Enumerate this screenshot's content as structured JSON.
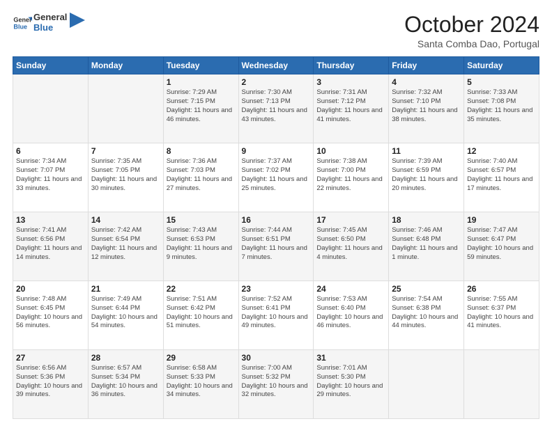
{
  "logo": {
    "text_general": "General",
    "text_blue": "Blue"
  },
  "header": {
    "title": "October 2024",
    "subtitle": "Santa Comba Dao, Portugal"
  },
  "weekdays": [
    "Sunday",
    "Monday",
    "Tuesday",
    "Wednesday",
    "Thursday",
    "Friday",
    "Saturday"
  ],
  "weeks": [
    [
      {
        "day": "",
        "sunrise": "",
        "sunset": "",
        "daylight": ""
      },
      {
        "day": "",
        "sunrise": "",
        "sunset": "",
        "daylight": ""
      },
      {
        "day": "1",
        "sunrise": "Sunrise: 7:29 AM",
        "sunset": "Sunset: 7:15 PM",
        "daylight": "Daylight: 11 hours and 46 minutes."
      },
      {
        "day": "2",
        "sunrise": "Sunrise: 7:30 AM",
        "sunset": "Sunset: 7:13 PM",
        "daylight": "Daylight: 11 hours and 43 minutes."
      },
      {
        "day": "3",
        "sunrise": "Sunrise: 7:31 AM",
        "sunset": "Sunset: 7:12 PM",
        "daylight": "Daylight: 11 hours and 41 minutes."
      },
      {
        "day": "4",
        "sunrise": "Sunrise: 7:32 AM",
        "sunset": "Sunset: 7:10 PM",
        "daylight": "Daylight: 11 hours and 38 minutes."
      },
      {
        "day": "5",
        "sunrise": "Sunrise: 7:33 AM",
        "sunset": "Sunset: 7:08 PM",
        "daylight": "Daylight: 11 hours and 35 minutes."
      }
    ],
    [
      {
        "day": "6",
        "sunrise": "Sunrise: 7:34 AM",
        "sunset": "Sunset: 7:07 PM",
        "daylight": "Daylight: 11 hours and 33 minutes."
      },
      {
        "day": "7",
        "sunrise": "Sunrise: 7:35 AM",
        "sunset": "Sunset: 7:05 PM",
        "daylight": "Daylight: 11 hours and 30 minutes."
      },
      {
        "day": "8",
        "sunrise": "Sunrise: 7:36 AM",
        "sunset": "Sunset: 7:03 PM",
        "daylight": "Daylight: 11 hours and 27 minutes."
      },
      {
        "day": "9",
        "sunrise": "Sunrise: 7:37 AM",
        "sunset": "Sunset: 7:02 PM",
        "daylight": "Daylight: 11 hours and 25 minutes."
      },
      {
        "day": "10",
        "sunrise": "Sunrise: 7:38 AM",
        "sunset": "Sunset: 7:00 PM",
        "daylight": "Daylight: 11 hours and 22 minutes."
      },
      {
        "day": "11",
        "sunrise": "Sunrise: 7:39 AM",
        "sunset": "Sunset: 6:59 PM",
        "daylight": "Daylight: 11 hours and 20 minutes."
      },
      {
        "day": "12",
        "sunrise": "Sunrise: 7:40 AM",
        "sunset": "Sunset: 6:57 PM",
        "daylight": "Daylight: 11 hours and 17 minutes."
      }
    ],
    [
      {
        "day": "13",
        "sunrise": "Sunrise: 7:41 AM",
        "sunset": "Sunset: 6:56 PM",
        "daylight": "Daylight: 11 hours and 14 minutes."
      },
      {
        "day": "14",
        "sunrise": "Sunrise: 7:42 AM",
        "sunset": "Sunset: 6:54 PM",
        "daylight": "Daylight: 11 hours and 12 minutes."
      },
      {
        "day": "15",
        "sunrise": "Sunrise: 7:43 AM",
        "sunset": "Sunset: 6:53 PM",
        "daylight": "Daylight: 11 hours and 9 minutes."
      },
      {
        "day": "16",
        "sunrise": "Sunrise: 7:44 AM",
        "sunset": "Sunset: 6:51 PM",
        "daylight": "Daylight: 11 hours and 7 minutes."
      },
      {
        "day": "17",
        "sunrise": "Sunrise: 7:45 AM",
        "sunset": "Sunset: 6:50 PM",
        "daylight": "Daylight: 11 hours and 4 minutes."
      },
      {
        "day": "18",
        "sunrise": "Sunrise: 7:46 AM",
        "sunset": "Sunset: 6:48 PM",
        "daylight": "Daylight: 11 hours and 1 minute."
      },
      {
        "day": "19",
        "sunrise": "Sunrise: 7:47 AM",
        "sunset": "Sunset: 6:47 PM",
        "daylight": "Daylight: 10 hours and 59 minutes."
      }
    ],
    [
      {
        "day": "20",
        "sunrise": "Sunrise: 7:48 AM",
        "sunset": "Sunset: 6:45 PM",
        "daylight": "Daylight: 10 hours and 56 minutes."
      },
      {
        "day": "21",
        "sunrise": "Sunrise: 7:49 AM",
        "sunset": "Sunset: 6:44 PM",
        "daylight": "Daylight: 10 hours and 54 minutes."
      },
      {
        "day": "22",
        "sunrise": "Sunrise: 7:51 AM",
        "sunset": "Sunset: 6:42 PM",
        "daylight": "Daylight: 10 hours and 51 minutes."
      },
      {
        "day": "23",
        "sunrise": "Sunrise: 7:52 AM",
        "sunset": "Sunset: 6:41 PM",
        "daylight": "Daylight: 10 hours and 49 minutes."
      },
      {
        "day": "24",
        "sunrise": "Sunrise: 7:53 AM",
        "sunset": "Sunset: 6:40 PM",
        "daylight": "Daylight: 10 hours and 46 minutes."
      },
      {
        "day": "25",
        "sunrise": "Sunrise: 7:54 AM",
        "sunset": "Sunset: 6:38 PM",
        "daylight": "Daylight: 10 hours and 44 minutes."
      },
      {
        "day": "26",
        "sunrise": "Sunrise: 7:55 AM",
        "sunset": "Sunset: 6:37 PM",
        "daylight": "Daylight: 10 hours and 41 minutes."
      }
    ],
    [
      {
        "day": "27",
        "sunrise": "Sunrise: 6:56 AM",
        "sunset": "Sunset: 5:36 PM",
        "daylight": "Daylight: 10 hours and 39 minutes."
      },
      {
        "day": "28",
        "sunrise": "Sunrise: 6:57 AM",
        "sunset": "Sunset: 5:34 PM",
        "daylight": "Daylight: 10 hours and 36 minutes."
      },
      {
        "day": "29",
        "sunrise": "Sunrise: 6:58 AM",
        "sunset": "Sunset: 5:33 PM",
        "daylight": "Daylight: 10 hours and 34 minutes."
      },
      {
        "day": "30",
        "sunrise": "Sunrise: 7:00 AM",
        "sunset": "Sunset: 5:32 PM",
        "daylight": "Daylight: 10 hours and 32 minutes."
      },
      {
        "day": "31",
        "sunrise": "Sunrise: 7:01 AM",
        "sunset": "Sunset: 5:30 PM",
        "daylight": "Daylight: 10 hours and 29 minutes."
      },
      {
        "day": "",
        "sunrise": "",
        "sunset": "",
        "daylight": ""
      },
      {
        "day": "",
        "sunrise": "",
        "sunset": "",
        "daylight": ""
      }
    ]
  ]
}
